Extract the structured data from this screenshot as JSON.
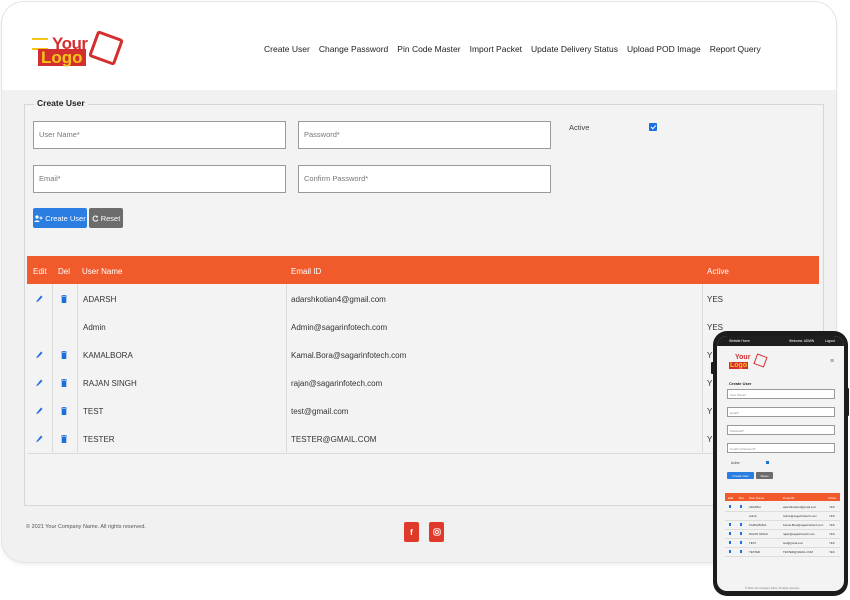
{
  "logo": {
    "line1": "Your",
    "line2": "Logo"
  },
  "nav": [
    "Create User",
    "Change Password",
    "Pin Code Master",
    "Import Packet",
    "Update Delivery Status",
    "Upload POD Image",
    "Report Query"
  ],
  "form": {
    "legend": "Create User",
    "username_placeholder": "User Name*",
    "password_placeholder": "Password*",
    "email_placeholder": "Email*",
    "confirm_placeholder": "Confirm Password*",
    "active_label": "Active",
    "active_checked": true,
    "create_button": "Create User",
    "reset_button": "Reset"
  },
  "table": {
    "headers": {
      "edit": "Edit",
      "del": "Del",
      "name": "User Name",
      "email": "Email ID",
      "active": "Active"
    },
    "rows": [
      {
        "name": "ADARSH",
        "email": "adarshkotian4@gmail.com",
        "active": "YES",
        "editable": true
      },
      {
        "name": "Admin",
        "email": "Admin@sagarinfotech.com",
        "active": "YES",
        "editable": false
      },
      {
        "name": "KAMALBORA",
        "email": "Kamal.Bora@sagarinfotech.com",
        "active": "YES",
        "editable": true
      },
      {
        "name": "RAJAN SINGH",
        "email": "rajan@sagarinfotech.com",
        "active": "YES",
        "editable": true
      },
      {
        "name": "TEST",
        "email": "test@gmail.com",
        "active": "YES",
        "editable": true
      },
      {
        "name": "TESTER",
        "email": "TESTER@GMAIL.COM",
        "active": "YES",
        "editable": true
      }
    ]
  },
  "footer": {
    "copyright": "© 2021 Your Company Name. All rights reserved.",
    "social": [
      "facebook-icon",
      "instagram-icon"
    ]
  },
  "mobile": {
    "topbar_left": "Website Home",
    "topbar_mid": "Welcome, ADMIN",
    "topbar_right": "Logout",
    "title": "Create User",
    "fields": [
      "User Name*",
      "Email*",
      "Password*",
      "Confirm Password*"
    ],
    "active_label": "Active",
    "create_button": "Create User",
    "reset_button": "Reset",
    "headers": [
      "Edit",
      "Del",
      "User Name",
      "Email ID",
      "Active"
    ]
  },
  "colors": {
    "accent": "#f15a2b",
    "primary": "#2a7de1",
    "secondary": "#6c6c6c",
    "social": "#e03a2b"
  }
}
